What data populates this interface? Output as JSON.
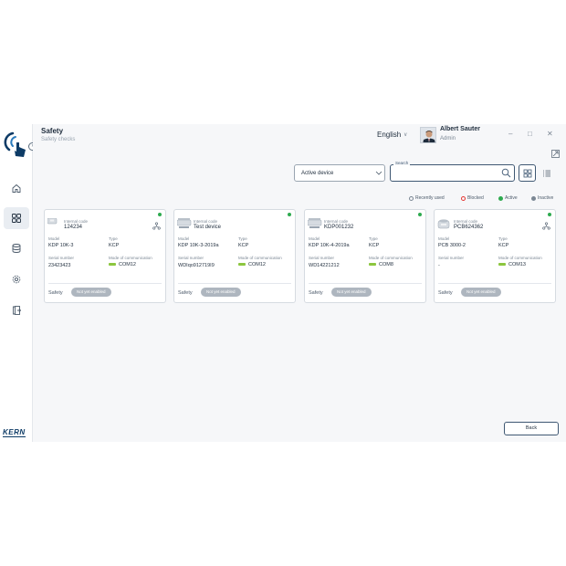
{
  "header": {
    "title": "Safety",
    "subtitle": "Safety checks",
    "language": "English",
    "user_name": "Albert Sauter",
    "user_role": "Admin"
  },
  "sidebar": {
    "brand": "KERN",
    "items": [
      {
        "icon": "home-icon"
      },
      {
        "icon": "grid-icon"
      },
      {
        "icon": "database-icon"
      },
      {
        "icon": "gear-icon"
      },
      {
        "icon": "logout-icon"
      }
    ]
  },
  "filter": {
    "selected": "Active device"
  },
  "search": {
    "label": "Search",
    "value": ""
  },
  "legend": {
    "recently_used": "Recently used",
    "blocked": "Blocked",
    "active": "Active",
    "inactive": "Inactive"
  },
  "labels": {
    "internal_code": "Internal code",
    "model": "Model",
    "type": "Type",
    "serial_number": "Serial number",
    "mode_of_communication": "Mode of communication",
    "safety": "Safety",
    "not_yet_enabled": "Not yet enabled"
  },
  "cards": [
    {
      "internal_code": "124234",
      "model": "KDP 10K-3",
      "type": "KCP",
      "serial": "23423423",
      "comm": "COM12"
    },
    {
      "internal_code": "Test device",
      "model": "KDP 10K-3-2019a",
      "type": "KCP",
      "serial": "WDIqo912719I9",
      "comm": "COM12"
    },
    {
      "internal_code": "KDP001232",
      "model": "KDP 10K-4-2019a",
      "type": "KCP",
      "serial": "WD14221212",
      "comm": "COM8"
    },
    {
      "internal_code": "PCB624362",
      "model": "PCB 3000-2",
      "type": "KCP",
      "serial": "-",
      "comm": "COM13"
    }
  ],
  "footer": {
    "back_label": "Back"
  },
  "colors": {
    "active": "#2eaa4f",
    "blocked": "#e53935",
    "inactive": "#7b8794",
    "accent": "#3f5873"
  }
}
